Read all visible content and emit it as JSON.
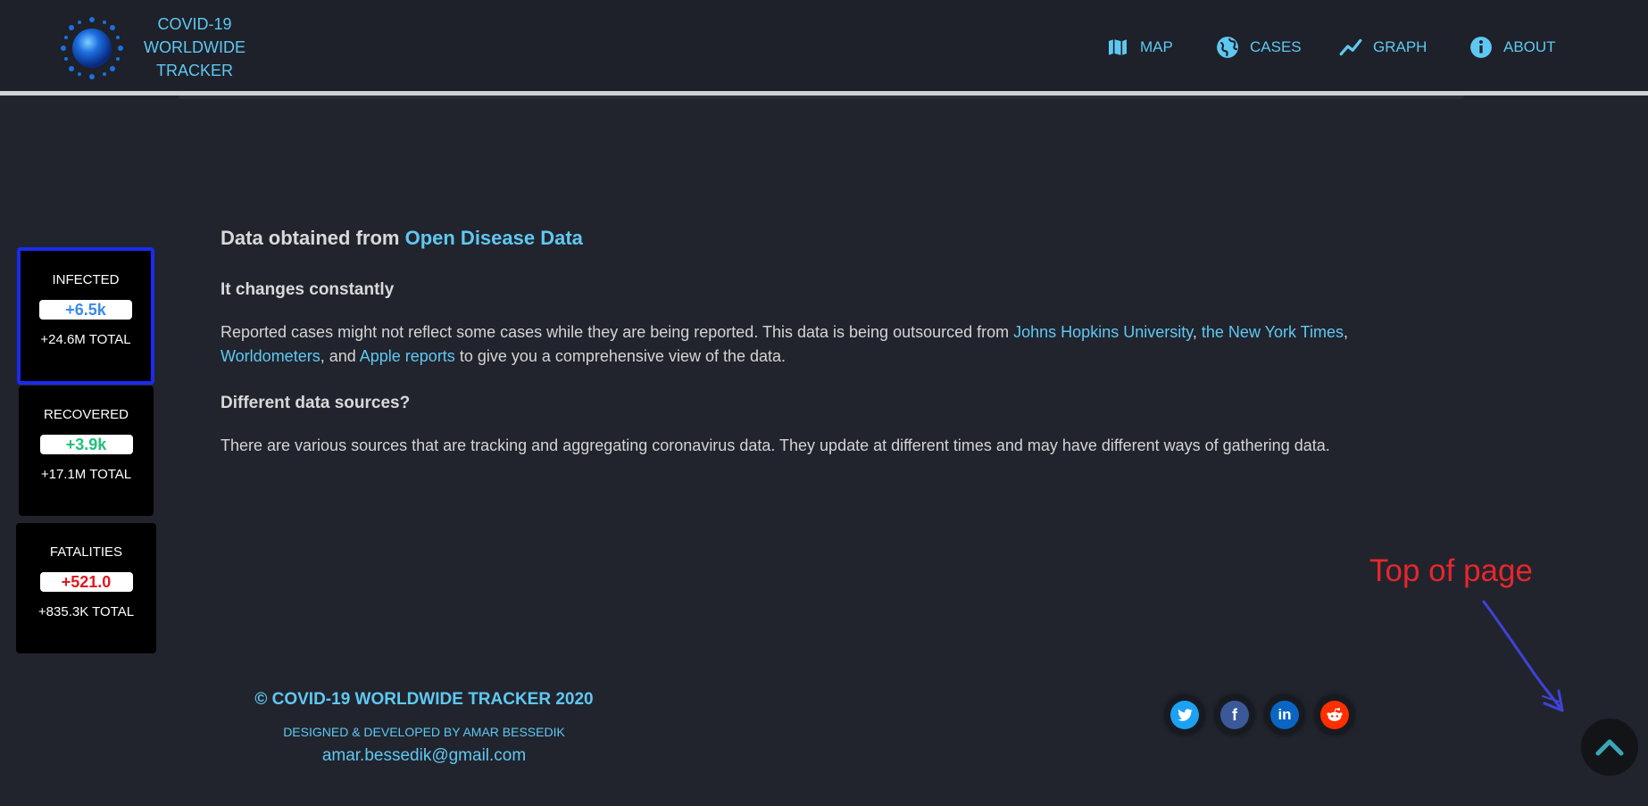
{
  "header": {
    "brand_line1": "COVID-19",
    "brand_line2": "WORLDWIDE",
    "brand_line3": "TRACKER",
    "nav": [
      {
        "label": "MAP",
        "icon": "map-icon"
      },
      {
        "label": "CASES",
        "icon": "globe-icon"
      },
      {
        "label": "GRAPH",
        "icon": "chart-line-icon"
      },
      {
        "label": "ABOUT",
        "icon": "info-icon"
      }
    ]
  },
  "stats": {
    "infected": {
      "title": "INFECTED",
      "delta": "+6.5k",
      "total": "+24.6M TOTAL",
      "color": "#3a8be8"
    },
    "recovered": {
      "title": "RECOVERED",
      "delta": "+3.9k",
      "total": "+17.1M TOTAL",
      "color": "#21c07a"
    },
    "fatalities": {
      "title": "FATALITIES",
      "delta": "+521.0",
      "total": "+835.3K TOTAL",
      "color": "#e0191e"
    }
  },
  "about": {
    "heading_prefix": "Data obtained from",
    "heading_link": "Open Disease Data",
    "sub1": "It changes constantly",
    "para1_a": "Reported cases might not reflect some cases while they are being reported. This data is being outsourced from ",
    "link_jhu": "Johns Hopkins University",
    "comma1": ", ",
    "link_nyt": "the New York Times",
    "comma2": ", ",
    "link_worldometers": "Worldometers",
    "and": ", and ",
    "link_apple": "Apple reports",
    "para1_b": " to give you a comprehensive view of the data.",
    "sub2": "Different data sources?",
    "para2": "There are various sources that are tracking and aggregating coronavirus data. They update at different times and may have different ways of gathering data."
  },
  "footer": {
    "title": "© COVID-19 WORLDWIDE TRACKER 2020",
    "designed": "DESIGNED & DEVELOPED BY AMAR BESSEDIK",
    "email": "amar.bessedik@gmail.com",
    "social": [
      {
        "icon": "twitter-icon",
        "color": "#1da1f2"
      },
      {
        "icon": "facebook-icon",
        "color": "#3b5998"
      },
      {
        "icon": "linkedin-icon",
        "color": "#0a66c2"
      },
      {
        "icon": "reddit-icon",
        "color": "#ff2f00"
      }
    ]
  },
  "annotation": {
    "label": "Top of page",
    "label_color": "#e8262d",
    "arrow_color": "#3f43d8"
  },
  "colors": {
    "accent": "#5fc8f2",
    "background": "#21242d",
    "active_border": "#1a2bf0"
  }
}
